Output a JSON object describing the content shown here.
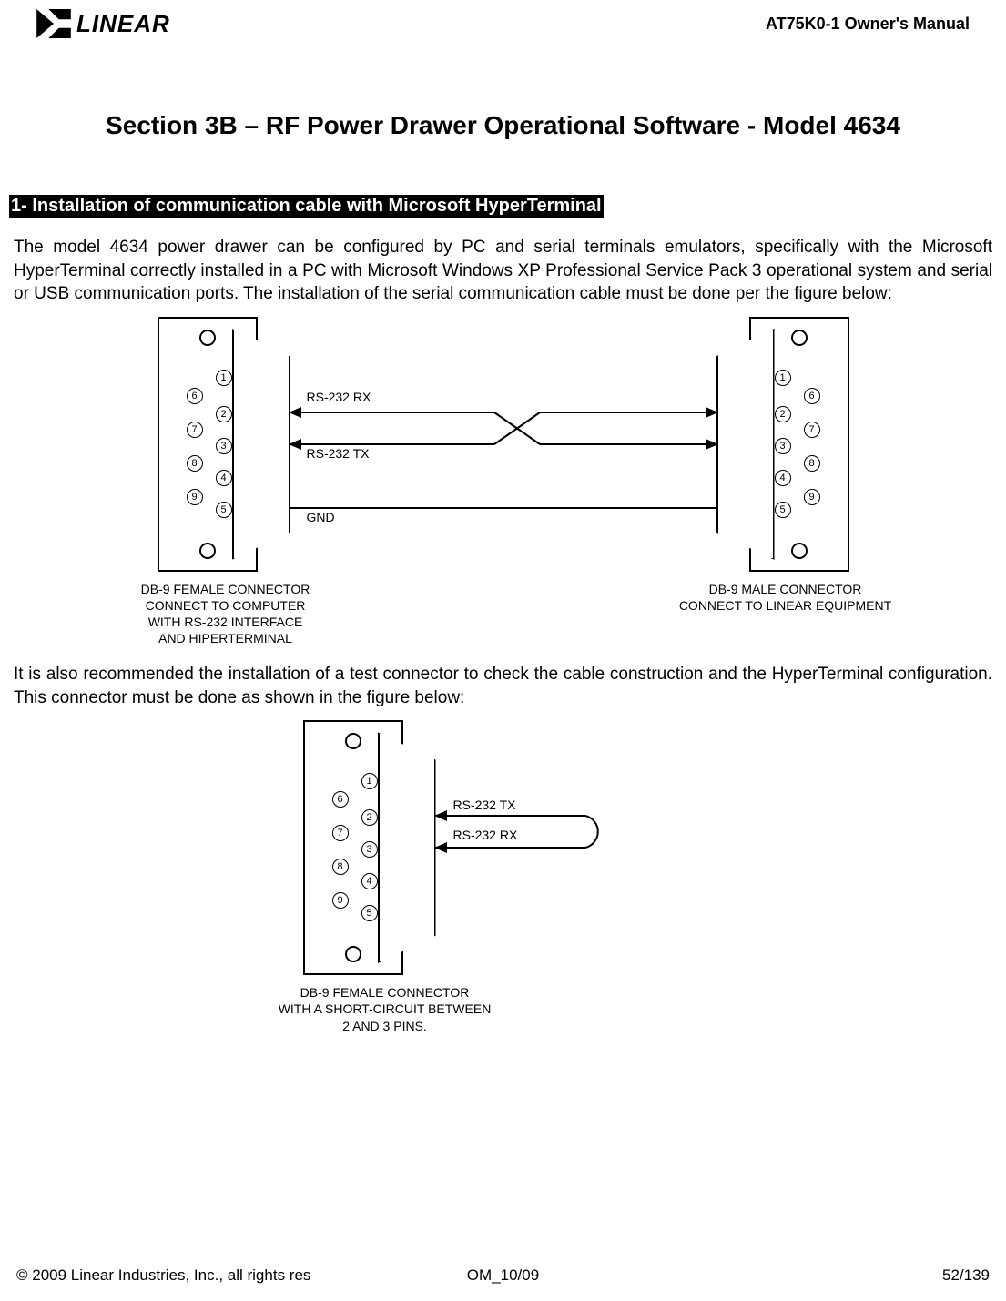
{
  "header": {
    "logo_text": "LINEAR",
    "manual_title": "AT75K0-1 Owner's Manual"
  },
  "section_title": "Section 3B – RF Power Drawer Operational Software - Model 4634",
  "sub_heading": "1- Installation of communication cable with Microsoft HyperTerminal",
  "paragraph1": "The model 4634 power drawer can be configured by PC and serial terminals emulators, specifically with the Microsoft HyperTerminal correctly installed in a PC with Microsoft Windows XP Professional Service Pack 3 operational system and serial or USB communication ports. The installation of the serial communication cable must be done per the figure below:",
  "diagram1": {
    "left_connector": {
      "pins_col1": [
        "1",
        "2",
        "3",
        "4",
        "5"
      ],
      "pins_col2": [
        "6",
        "7",
        "8",
        "9"
      ],
      "caption": "DB-9 FEMALE CONNECTOR\nCONNECT TO COMPUTER\nWITH RS-232 INTERFACE\nAND HIPERTERMINAL"
    },
    "right_connector": {
      "pins_col1": [
        "1",
        "2",
        "3",
        "4",
        "5"
      ],
      "pins_col2": [
        "6",
        "7",
        "8",
        "9"
      ],
      "caption": "DB-9 MALE CONNECTOR\nCONNECT TO LINEAR EQUIPMENT"
    },
    "wire_labels": {
      "rx": "RS-232 RX",
      "tx": "RS-232 TX",
      "gnd": "GND"
    }
  },
  "paragraph2": "It is also recommended the installation of a test connector to check the cable construction and the HyperTerminal configuration. This connector must be done as shown in the figure below:",
  "diagram2": {
    "connector": {
      "pins_col1": [
        "1",
        "2",
        "3",
        "4",
        "5"
      ],
      "pins_col2": [
        "6",
        "7",
        "8",
        "9"
      ],
      "caption": "DB-9 FEMALE CONNECTOR\nWITH A SHORT-CIRCUIT BETWEEN\n2 AND 3 PINS."
    },
    "wire_labels": {
      "tx": "RS-232 TX",
      "rx": "RS-232 RX"
    }
  },
  "footer": {
    "left": "© 2009 Linear Industries, Inc., all rights res",
    "center": "OM_10/09",
    "right": "52/139"
  }
}
